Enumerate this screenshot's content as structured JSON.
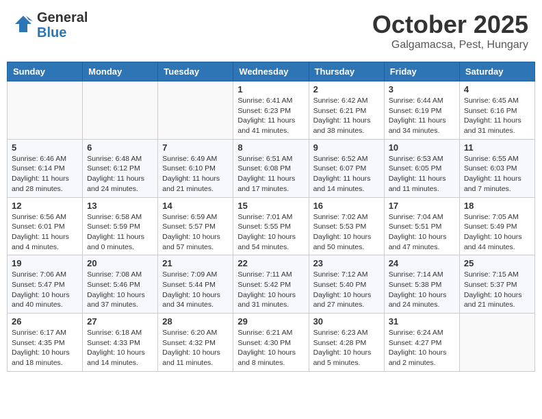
{
  "header": {
    "logo_general": "General",
    "logo_blue": "Blue",
    "month": "October 2025",
    "location": "Galgamacsa, Pest, Hungary"
  },
  "weekdays": [
    "Sunday",
    "Monday",
    "Tuesday",
    "Wednesday",
    "Thursday",
    "Friday",
    "Saturday"
  ],
  "weeks": [
    [
      {
        "day": "",
        "info": ""
      },
      {
        "day": "",
        "info": ""
      },
      {
        "day": "",
        "info": ""
      },
      {
        "day": "1",
        "info": "Sunrise: 6:41 AM\nSunset: 6:23 PM\nDaylight: 11 hours\nand 41 minutes."
      },
      {
        "day": "2",
        "info": "Sunrise: 6:42 AM\nSunset: 6:21 PM\nDaylight: 11 hours\nand 38 minutes."
      },
      {
        "day": "3",
        "info": "Sunrise: 6:44 AM\nSunset: 6:19 PM\nDaylight: 11 hours\nand 34 minutes."
      },
      {
        "day": "4",
        "info": "Sunrise: 6:45 AM\nSunset: 6:16 PM\nDaylight: 11 hours\nand 31 minutes."
      }
    ],
    [
      {
        "day": "5",
        "info": "Sunrise: 6:46 AM\nSunset: 6:14 PM\nDaylight: 11 hours\nand 28 minutes."
      },
      {
        "day": "6",
        "info": "Sunrise: 6:48 AM\nSunset: 6:12 PM\nDaylight: 11 hours\nand 24 minutes."
      },
      {
        "day": "7",
        "info": "Sunrise: 6:49 AM\nSunset: 6:10 PM\nDaylight: 11 hours\nand 21 minutes."
      },
      {
        "day": "8",
        "info": "Sunrise: 6:51 AM\nSunset: 6:08 PM\nDaylight: 11 hours\nand 17 minutes."
      },
      {
        "day": "9",
        "info": "Sunrise: 6:52 AM\nSunset: 6:07 PM\nDaylight: 11 hours\nand 14 minutes."
      },
      {
        "day": "10",
        "info": "Sunrise: 6:53 AM\nSunset: 6:05 PM\nDaylight: 11 hours\nand 11 minutes."
      },
      {
        "day": "11",
        "info": "Sunrise: 6:55 AM\nSunset: 6:03 PM\nDaylight: 11 hours\nand 7 minutes."
      }
    ],
    [
      {
        "day": "12",
        "info": "Sunrise: 6:56 AM\nSunset: 6:01 PM\nDaylight: 11 hours\nand 4 minutes."
      },
      {
        "day": "13",
        "info": "Sunrise: 6:58 AM\nSunset: 5:59 PM\nDaylight: 11 hours\nand 0 minutes."
      },
      {
        "day": "14",
        "info": "Sunrise: 6:59 AM\nSunset: 5:57 PM\nDaylight: 10 hours\nand 57 minutes."
      },
      {
        "day": "15",
        "info": "Sunrise: 7:01 AM\nSunset: 5:55 PM\nDaylight: 10 hours\nand 54 minutes."
      },
      {
        "day": "16",
        "info": "Sunrise: 7:02 AM\nSunset: 5:53 PM\nDaylight: 10 hours\nand 50 minutes."
      },
      {
        "day": "17",
        "info": "Sunrise: 7:04 AM\nSunset: 5:51 PM\nDaylight: 10 hours\nand 47 minutes."
      },
      {
        "day": "18",
        "info": "Sunrise: 7:05 AM\nSunset: 5:49 PM\nDaylight: 10 hours\nand 44 minutes."
      }
    ],
    [
      {
        "day": "19",
        "info": "Sunrise: 7:06 AM\nSunset: 5:47 PM\nDaylight: 10 hours\nand 40 minutes."
      },
      {
        "day": "20",
        "info": "Sunrise: 7:08 AM\nSunset: 5:46 PM\nDaylight: 10 hours\nand 37 minutes."
      },
      {
        "day": "21",
        "info": "Sunrise: 7:09 AM\nSunset: 5:44 PM\nDaylight: 10 hours\nand 34 minutes."
      },
      {
        "day": "22",
        "info": "Sunrise: 7:11 AM\nSunset: 5:42 PM\nDaylight: 10 hours\nand 31 minutes."
      },
      {
        "day": "23",
        "info": "Sunrise: 7:12 AM\nSunset: 5:40 PM\nDaylight: 10 hours\nand 27 minutes."
      },
      {
        "day": "24",
        "info": "Sunrise: 7:14 AM\nSunset: 5:38 PM\nDaylight: 10 hours\nand 24 minutes."
      },
      {
        "day": "25",
        "info": "Sunrise: 7:15 AM\nSunset: 5:37 PM\nDaylight: 10 hours\nand 21 minutes."
      }
    ],
    [
      {
        "day": "26",
        "info": "Sunrise: 6:17 AM\nSunset: 4:35 PM\nDaylight: 10 hours\nand 18 minutes."
      },
      {
        "day": "27",
        "info": "Sunrise: 6:18 AM\nSunset: 4:33 PM\nDaylight: 10 hours\nand 14 minutes."
      },
      {
        "day": "28",
        "info": "Sunrise: 6:20 AM\nSunset: 4:32 PM\nDaylight: 10 hours\nand 11 minutes."
      },
      {
        "day": "29",
        "info": "Sunrise: 6:21 AM\nSunset: 4:30 PM\nDaylight: 10 hours\nand 8 minutes."
      },
      {
        "day": "30",
        "info": "Sunrise: 6:23 AM\nSunset: 4:28 PM\nDaylight: 10 hours\nand 5 minutes."
      },
      {
        "day": "31",
        "info": "Sunrise: 6:24 AM\nSunset: 4:27 PM\nDaylight: 10 hours\nand 2 minutes."
      },
      {
        "day": "",
        "info": ""
      }
    ]
  ]
}
